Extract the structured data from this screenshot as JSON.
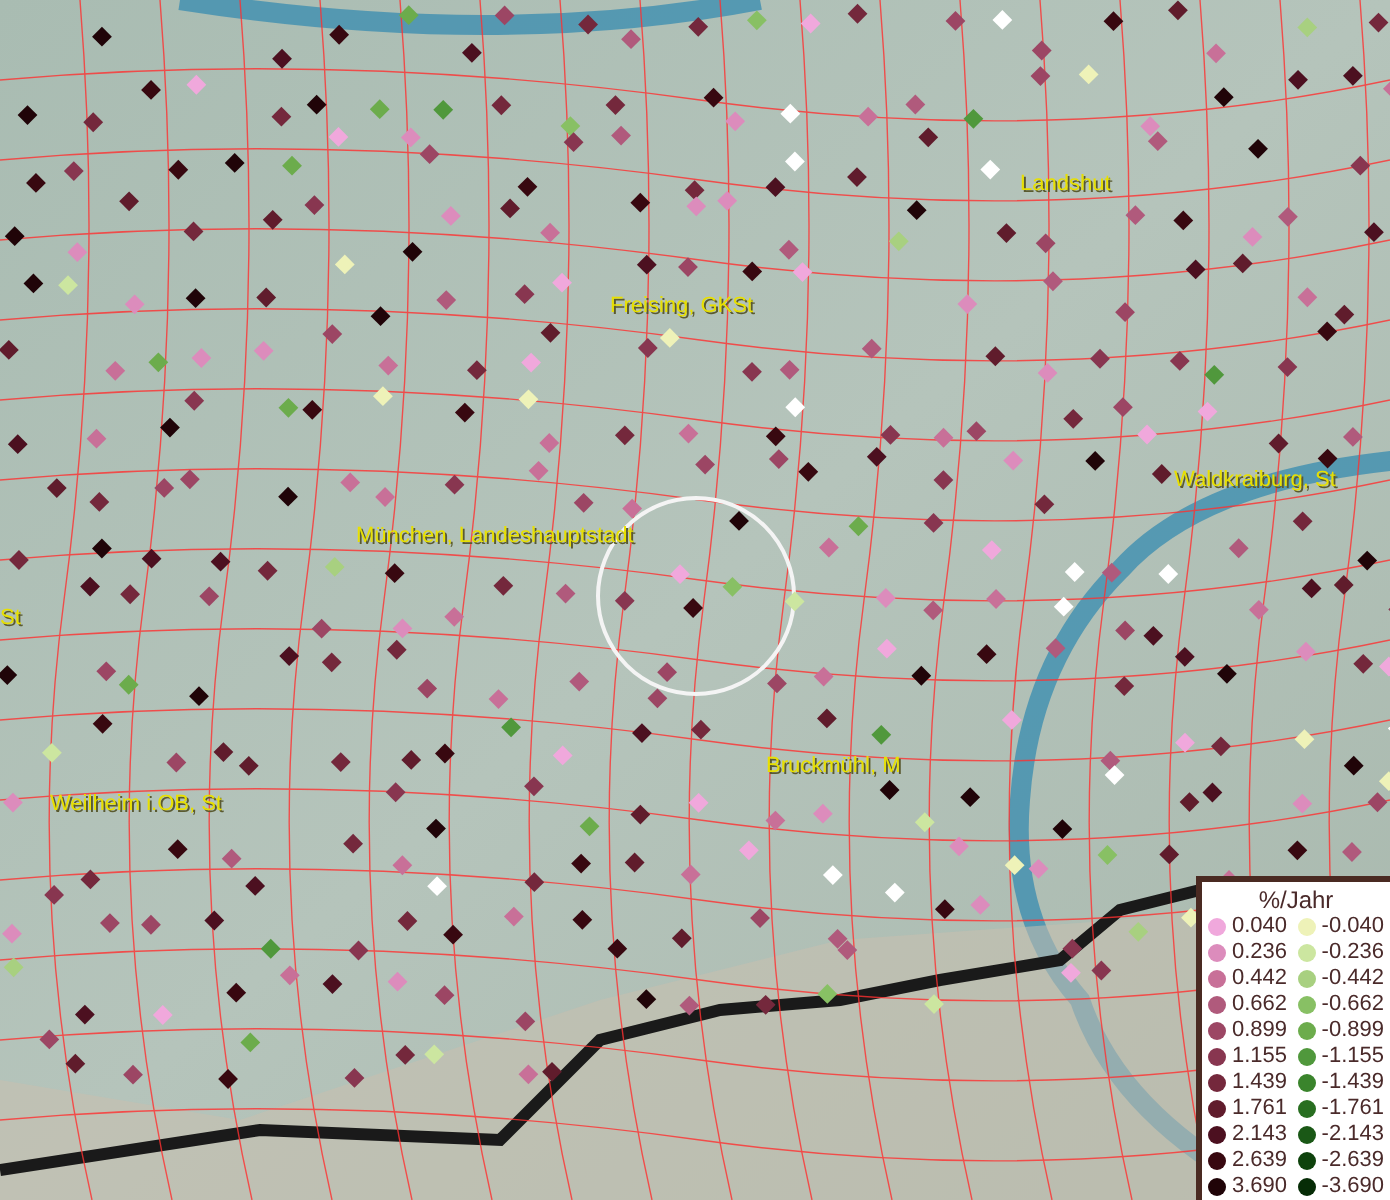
{
  "map_labels": [
    {
      "text": "Landshut"
    },
    {
      "text": "Freising, GKSt"
    },
    {
      "text": "Waldkraiburg, St"
    },
    {
      "text": "München, Landeshauptstadt"
    },
    {
      "text": "St"
    },
    {
      "text": "Bruckmühl, M"
    },
    {
      "text": "Weilheim i.OB, St"
    }
  ],
  "legend": {
    "title": "%/Jahr",
    "items": [
      {
        "label": "0.040",
        "color": "#f0a8dc"
      },
      {
        "label": "-0.040",
        "color": "#eef2b8"
      },
      {
        "label": "0.236",
        "color": "#dc8cbc"
      },
      {
        "label": "-0.236",
        "color": "#cce6a0"
      },
      {
        "label": "0.442",
        "color": "#c87098"
      },
      {
        "label": "-0.442",
        "color": "#a8d080"
      },
      {
        "label": "0.662",
        "color": "#b05a7c"
      },
      {
        "label": "-0.662",
        "color": "#88c064"
      },
      {
        "label": "0.899",
        "color": "#9c4664"
      },
      {
        "label": "-0.899",
        "color": "#6cac4c"
      },
      {
        "label": "1.155",
        "color": "#883650"
      },
      {
        "label": "-1.155",
        "color": "#50983c"
      },
      {
        "label": "1.439",
        "color": "#74283c"
      },
      {
        "label": "-1.439",
        "color": "#3a842c"
      },
      {
        "label": "1.761",
        "color": "#601c2c"
      },
      {
        "label": "-1.761",
        "color": "#286e20"
      },
      {
        "label": "2.143",
        "color": "#4c1020"
      },
      {
        "label": "-2.143",
        "color": "#1a5816"
      },
      {
        "label": "2.639",
        "color": "#380810"
      },
      {
        "label": "-2.639",
        "color": "#0e420c"
      },
      {
        "label": "3.690",
        "color": "#200408"
      },
      {
        "label": "-3.690",
        "color": "#062c06"
      }
    ]
  }
}
